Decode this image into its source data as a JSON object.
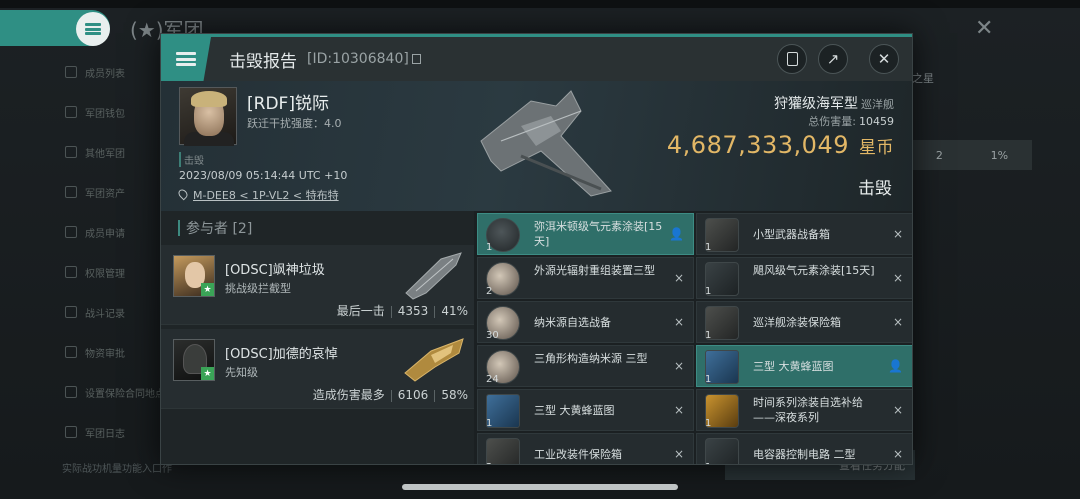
{
  "background": {
    "title": "军团",
    "sidebar": [
      "成员列表",
      "军团钱包",
      "其他军团",
      "军团资产",
      "成员申请",
      "权限管理",
      "战斗记录",
      "物资审批",
      "设置保险合同地点",
      "军团日志"
    ],
    "footer": "实际战功机量功能入口作",
    "right_label": "之星",
    "right_values": [
      "2",
      "1%"
    ],
    "footer_button": "查看任务分配"
  },
  "modal": {
    "title": "击毁报告",
    "id_text": "[ID:10306840]",
    "victim": {
      "name": "[RDF]锐际",
      "sub": "跃迁干扰强度：4.0",
      "tag": "击毁",
      "time": "2023/08/09 05:14:44 UTC +10",
      "location": "M-DEE8 < 1P-VL2 < 特布特"
    },
    "ship": {
      "name": "狩獾级海军型",
      "class": "巡洋舰",
      "total_damage_label": "总伤害量:",
      "total_damage": "10459",
      "value": "4,687,333,049",
      "value_unit": "星币",
      "status": "击毁"
    },
    "participants": {
      "header": "参与者 [2]",
      "rows": [
        {
          "name": "[ODSC]飒神垃圾",
          "ship": "挑战级拦截型",
          "label": "最后一击",
          "damage": "4353",
          "percent": "41%"
        },
        {
          "name": "[ODSC]加德的哀悼",
          "ship": "先知级",
          "label": "造成伤害最多",
          "damage": "6106",
          "percent": "58%"
        }
      ]
    },
    "items": [
      {
        "name": "弥洱米顿级气元素涂装[15天]",
        "qty": "1",
        "mark": "person",
        "highlight": true
      },
      {
        "name": "小型武器战备箱",
        "qty": "1",
        "mark": "×",
        "highlight": false
      },
      {
        "name": "外源光辐射重组装置三型",
        "qty": "2",
        "mark": "×",
        "highlight": false
      },
      {
        "name": "飓风级气元素涂装[15天]",
        "qty": "1",
        "mark": "×",
        "highlight": false
      },
      {
        "name": "纳米源自选战备",
        "qty": "30",
        "mark": "×",
        "highlight": false
      },
      {
        "name": "巡洋舰涂装保险箱",
        "qty": "1",
        "mark": "×",
        "highlight": false
      },
      {
        "name": "三角形构造纳米源 三型",
        "qty": "24",
        "mark": "×",
        "highlight": false
      },
      {
        "name": "三型 大黄蜂蓝图",
        "qty": "1",
        "mark": "person",
        "highlight": true
      },
      {
        "name": "三型 大黄蜂蓝图",
        "qty": "1",
        "mark": "×",
        "highlight": false
      },
      {
        "name": "时间系列涂装自选补给——深夜系列",
        "qty": "1",
        "mark": "×",
        "highlight": false
      },
      {
        "name": "工业改装件保险箱",
        "qty": "2",
        "mark": "×",
        "highlight": false
      },
      {
        "name": "电容器控制电路 二型",
        "qty": "1",
        "mark": "×",
        "highlight": false
      }
    ]
  }
}
